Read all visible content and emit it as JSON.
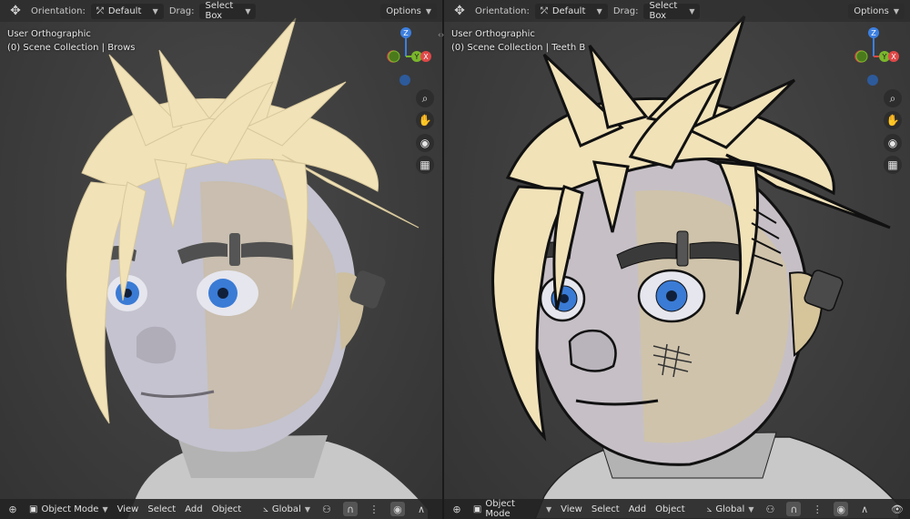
{
  "header": {
    "orientation_label": "Orientation:",
    "orientation_value": "Default",
    "drag_label": "Drag:",
    "drag_value": "Select Box",
    "options_label": "Options"
  },
  "left_viewport": {
    "view_name": "User Orthographic",
    "collection": "(0) Scene Collection | Brows"
  },
  "right_viewport": {
    "view_name": "User Orthographic",
    "collection": "(0) Scene Collection | Teeth B"
  },
  "gizmo": {
    "z": "Z",
    "y": "Y",
    "x": "X"
  },
  "footer": {
    "mode": "Object Mode",
    "menus": [
      "View",
      "Select",
      "Add",
      "Object"
    ],
    "transform": "Global"
  },
  "colors": {
    "axis_x": "#e04848",
    "axis_y": "#7ab72c",
    "axis_z": "#3c7fe0",
    "hair": "#f1e2b8",
    "skin": "#c9c6d3",
    "iris": "#3a7bd5"
  },
  "icons": [
    "transform-icon",
    "zoom-icon",
    "hand-icon",
    "camera-icon",
    "grid-icon",
    "editor-type-icon",
    "object-mode-icon",
    "snap-icon",
    "proportional-icon"
  ]
}
